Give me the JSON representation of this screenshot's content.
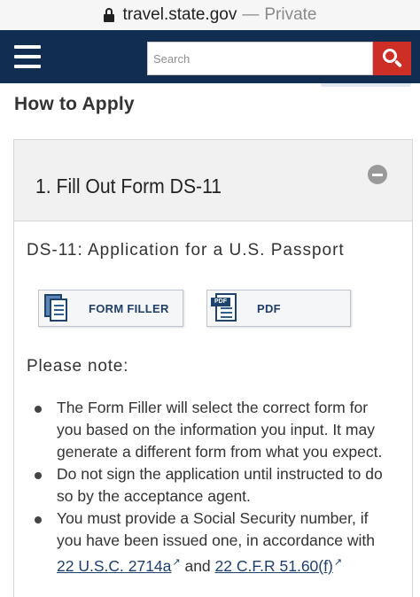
{
  "browser": {
    "domain": "travel.state.gov",
    "separator": "—",
    "mode": "Private"
  },
  "header": {
    "background_color": "#112e51",
    "menu_icon": "hamburger-menu-icon",
    "search": {
      "placeholder": "Search",
      "value": "",
      "button_icon": "search-icon",
      "button_color": "#cd2e26"
    }
  },
  "main": {
    "title": "How to Apply",
    "accordion": {
      "step_title": "1. Fill Out Form DS-11",
      "toggle_icon": "collapse-minus-icon",
      "form_name": "DS-11: Application for a U.S. Passport",
      "buttons": [
        {
          "label": "FORM FILLER",
          "icon": "form-filler-icon"
        },
        {
          "label": "PDF",
          "icon": "pdf-file-icon"
        }
      ],
      "note_heading": "Please note:",
      "notes": [
        "The Form Filler will select the correct form for you based on the information you input. It may generate a different form from what you expect.",
        "Do not sign the application until instructed to do so by the acceptance agent."
      ],
      "note3": {
        "text_before": "You must provide a Social Security number, if you have been issued one, in accordance with ",
        "link1": "22 U.S.C. 2714a",
        "text_middle": " and ",
        "link2": "22 C.F.R 51.60(f)",
        "external_link_icon": "external-link-icon"
      }
    }
  }
}
